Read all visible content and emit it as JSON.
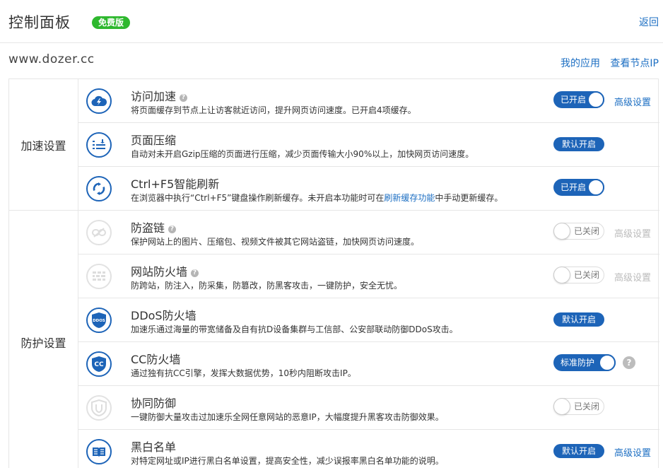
{
  "header": {
    "title": "控制面板",
    "badge": "免费版",
    "back_label": "返回"
  },
  "site": {
    "domain": "www.dozer.cc",
    "my_apps_label": "我的应用",
    "view_nodes_label": "查看节点IP"
  },
  "groups": [
    {
      "label": "加速设置"
    },
    {
      "label": "防护设置"
    }
  ],
  "rows": [
    {
      "title": "访问加速",
      "desc": "将页面缓存到节点上让访客就近访问，提升网页访问速度。已开启4项缓存。",
      "state": "已开启",
      "advanced": "高级设置",
      "icon": "cloud-bolt-icon"
    },
    {
      "title": "页面压缩",
      "desc": "自动对未开启Gzip压缩的页面进行压缩，减少页面传输大小90%以上，加快网页访问速度。",
      "state": "默认开启",
      "icon": "compress-list-icon"
    },
    {
      "title": "Ctrl+F5智能刷新",
      "desc_pre": "在浏览器中执行“Ctrl+F5”键盘操作刷新缓存。未开启本功能时可在",
      "desc_link": "刷新缓存功能",
      "desc_post": "中手动更新缓存。",
      "state": "已开启",
      "icon": "refresh-icon"
    },
    {
      "title": "防盗链",
      "desc": "保护网站上的图片、压缩包、视频文件被其它网站盗链，加快网页访问速度。",
      "state": "已关闭",
      "advanced": "高级设置",
      "icon": "link-icon"
    },
    {
      "title": "网站防火墙",
      "desc": "防跨站，防注入，防采集，防篡改，防黑客攻击，一键防护，安全无忧。",
      "state": "已关闭",
      "advanced": "高级设置",
      "icon": "firewall-icon"
    },
    {
      "title": "DDoS防火墙",
      "desc": "加速乐通过海量的带宽储备及自有抗D设备集群与工信部、公安部联动防御DDoS攻击。",
      "state": "默认开启",
      "icon": "ddos-shield-icon",
      "icon_text": "DDOS"
    },
    {
      "title": "CC防火墙",
      "desc": "通过独有抗CC引擎，发挥大数据优势，10秒内阻断攻击IP。",
      "state": "标准防护",
      "help": "?",
      "icon": "cc-shield-icon",
      "icon_text": "CC"
    },
    {
      "title": "协同防御",
      "desc": "一键防御大量攻击过加速乐全网任意网站的恶意IP，大幅度提升黑客攻击防御效果。",
      "state": "已关闭",
      "icon": "coop-shield-icon"
    },
    {
      "title": "黑白名单",
      "desc": "对特定网址或IP进行黑白名单设置，提高安全性，减少误报率黑白名单功能的说明。",
      "state": "默认开启",
      "advanced": "高级设置",
      "icon": "book-icon"
    }
  ],
  "colors": {
    "accent": "#1d64b8",
    "link": "#1d6fc3",
    "badge": "#2eb82e",
    "disabled": "#bbbbbb"
  }
}
